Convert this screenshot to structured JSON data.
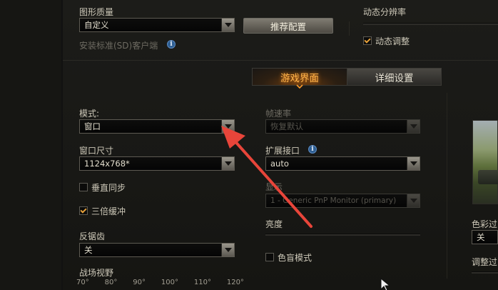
{
  "graphics": {
    "quality_label": "图形质量",
    "quality_value": "自定义",
    "recommend_button": "推荐配置",
    "install_sd_label": "安装标准(SD)客户端",
    "dynamic_resolution_label": "动态分辨率",
    "dynamic_adjust_label": "动态调整",
    "dynamic_adjust_checked": true
  },
  "tabs": [
    {
      "label": "游戏界面",
      "active": true
    },
    {
      "label": "详细设置",
      "active": false
    }
  ],
  "left": {
    "mode_label": "模式:",
    "mode_value": "窗口",
    "window_size_label": "窗口尺寸",
    "window_size_value": "1124x768*",
    "vsync_label": "垂直同步",
    "vsync_checked": false,
    "triple_buffer_label": "三倍缓冲",
    "triple_buffer_checked": true,
    "antialias_label": "反锯齿",
    "antialias_value": "关",
    "fov_label": "战场视野",
    "fov_ticks": [
      "70°",
      "80°",
      "90°",
      "100°",
      "110°",
      "120°"
    ]
  },
  "middle": {
    "framerate_label": "帧速率",
    "framerate_value": "恢复默认",
    "extension_label": "扩展接口",
    "extension_value": "auto",
    "display_label": "显示",
    "display_value": "1 - Generic PnP Monitor (primary)",
    "brightness_label": "亮度",
    "colorblind_label": "色盲模式",
    "colorblind_checked": false
  },
  "right": {
    "color_filter_label": "色彩过",
    "color_filter_value": "关",
    "adjust_label": "调整过"
  },
  "colors": {
    "accent_orange": "#ffb44a",
    "arrow_red": "#e8453a",
    "info_blue": "#2f5f93"
  },
  "icons": [
    "info-icon",
    "dropdown-arrow-icon",
    "checkbox-check-icon",
    "mouse-cursor-icon"
  ]
}
